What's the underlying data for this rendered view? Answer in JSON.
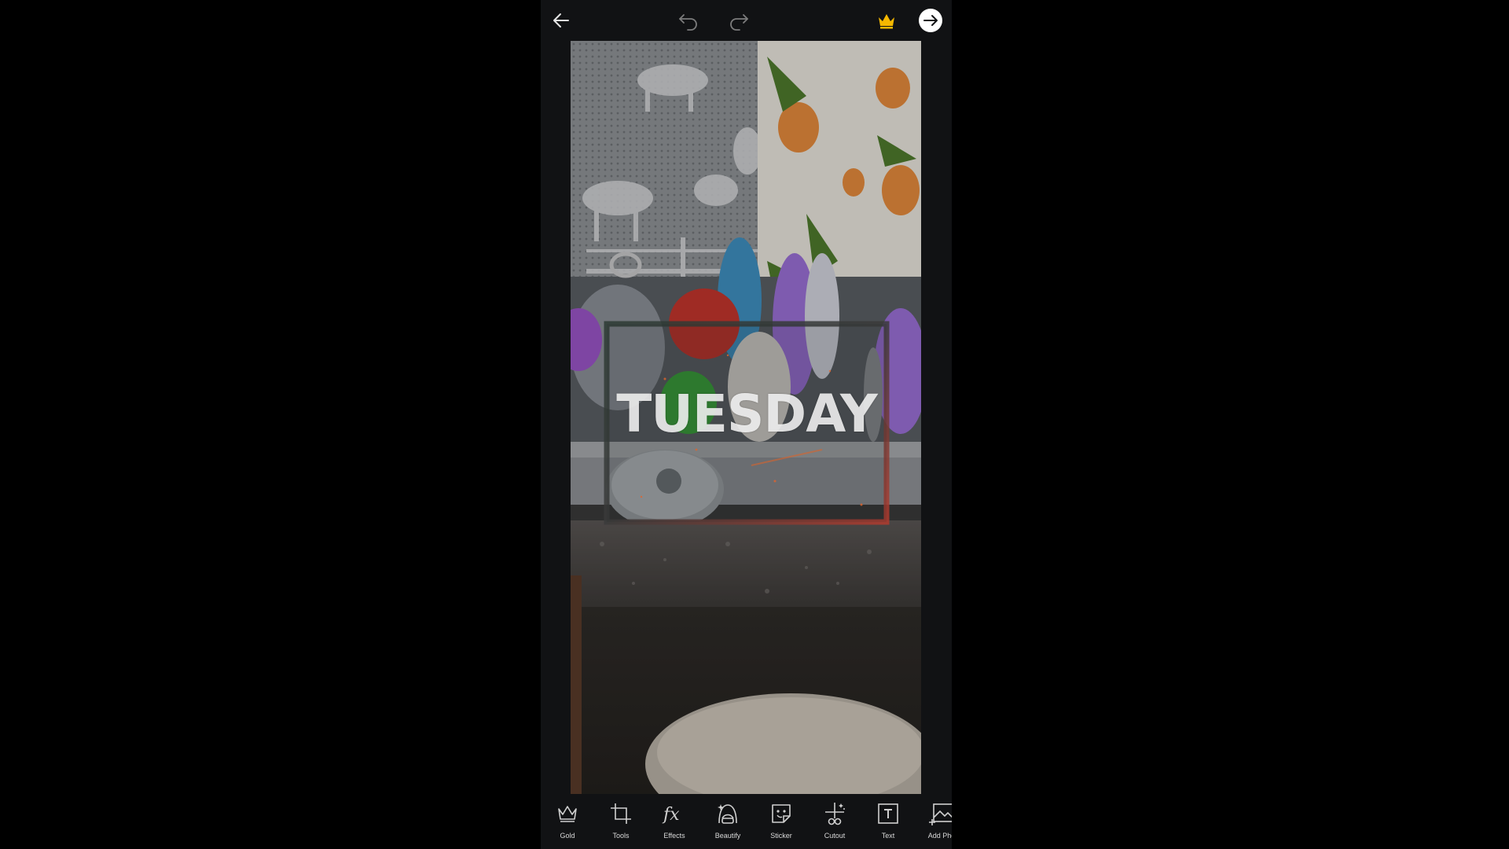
{
  "app": {
    "theme": {
      "background": "#111214",
      "accent_gold": "#f5b800",
      "icon_color": "#cfcfcf",
      "label_color": "#d9d9d9"
    }
  },
  "topbar": {
    "back_icon": "arrow-left-icon",
    "undo_icon": "undo-icon",
    "redo_icon": "redo-icon",
    "premium_icon": "crown-icon",
    "next_icon": "arrow-right-circle-icon"
  },
  "canvas": {
    "sticker_text": "TUESDAY"
  },
  "toolbar": {
    "items": [
      {
        "label": "Gold",
        "icon": "crown-outline-icon"
      },
      {
        "label": "Tools",
        "icon": "crop-icon"
      },
      {
        "label": "Effects",
        "icon": "fx-icon"
      },
      {
        "label": "Beautify",
        "icon": "face-icon"
      },
      {
        "label": "Sticker",
        "icon": "sticker-icon"
      },
      {
        "label": "Cutout",
        "icon": "scissors-icon"
      },
      {
        "label": "Text",
        "icon": "text-icon"
      },
      {
        "label": "Add Pho",
        "icon": "add-photo-icon"
      }
    ]
  }
}
